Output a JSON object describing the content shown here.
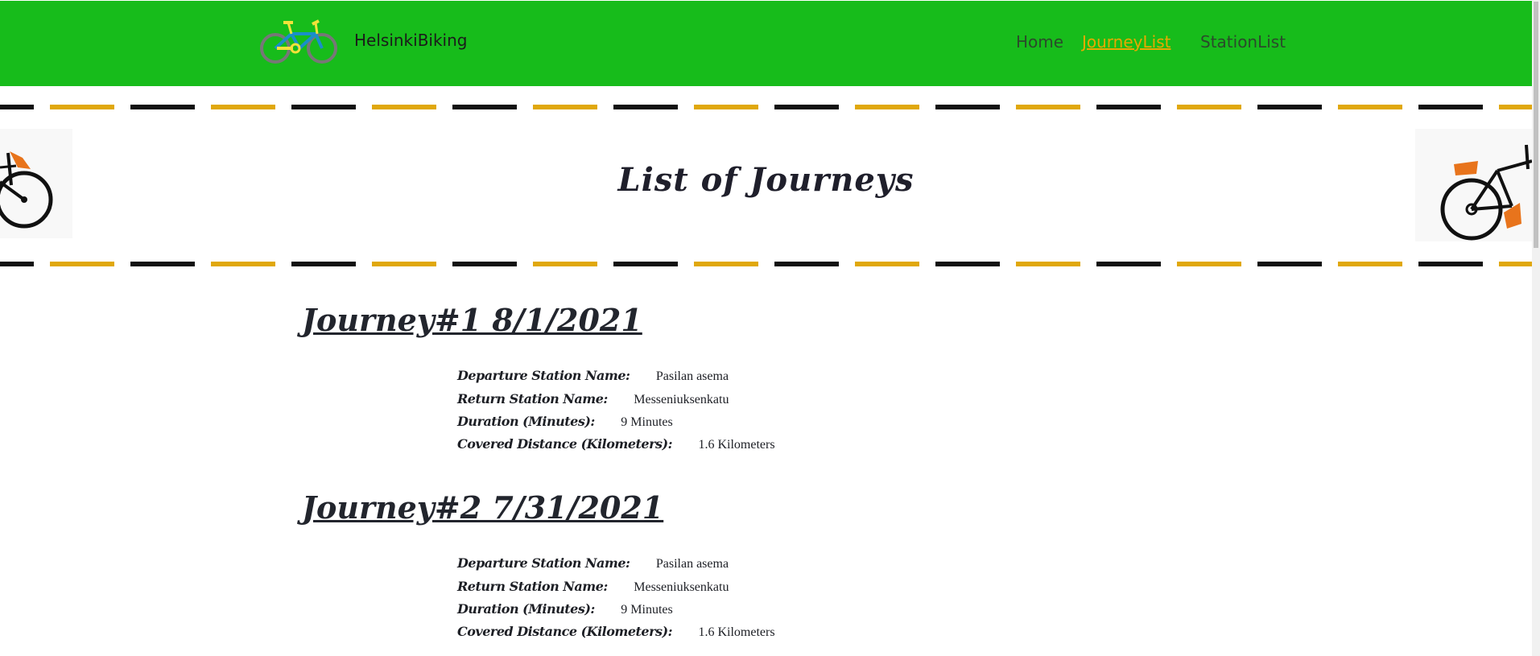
{
  "header": {
    "brand": "HelsinkiBiking",
    "nav": [
      {
        "label": "Home",
        "active": false
      },
      {
        "label": "JourneyList",
        "active": true
      },
      {
        "label": "StationList",
        "active": false
      }
    ]
  },
  "hero": {
    "title": "List of Journeys"
  },
  "journeys": [
    {
      "heading": "Journey#1 8/1/2021",
      "fields": [
        {
          "label": "Departure Station Name:",
          "value": "Pasilan asema"
        },
        {
          "label": "Return Station Name:",
          "value": "Messeniuksenkatu"
        },
        {
          "label": "Duration (Minutes):",
          "value": "9 Minutes"
        },
        {
          "label": "Covered Distance (Kilometers):",
          "value": "1.6 Kilometers"
        }
      ]
    },
    {
      "heading": "Journey#2 7/31/2021",
      "fields": [
        {
          "label": "Departure Station Name:",
          "value": "Pasilan asema"
        },
        {
          "label": "Return Station Name:",
          "value": "Messeniuksenkatu"
        },
        {
          "label": "Duration (Minutes):",
          "value": "9 Minutes"
        },
        {
          "label": "Covered Distance (Kilometers):",
          "value": "1.6 Kilometers"
        }
      ]
    }
  ],
  "colors": {
    "header_bg": "#17bc1b",
    "active_link": "#e8a800",
    "dash_yellow": "#e0a80c",
    "dash_black": "#111111"
  },
  "icons": [
    "bicycle-logo-icon",
    "bicycle-left-icon",
    "bicycle-right-icon"
  ]
}
